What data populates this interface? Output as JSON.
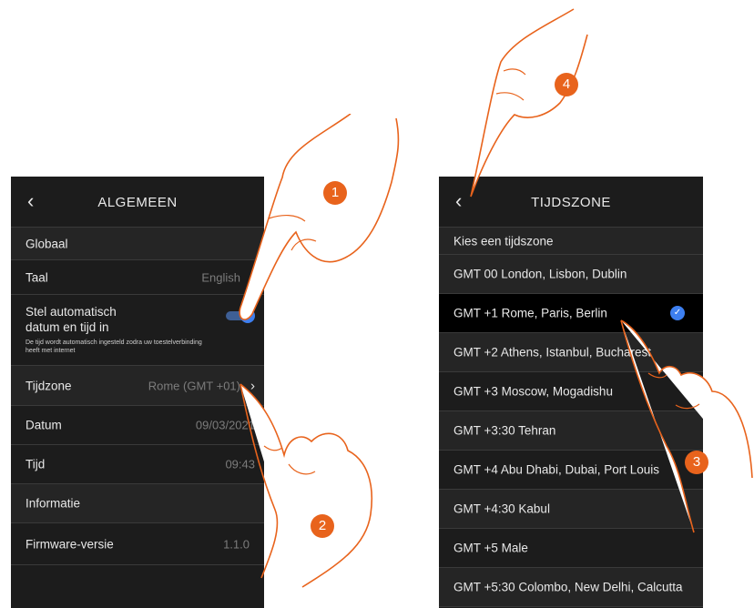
{
  "left": {
    "title": "ALGEMEEN",
    "back_icon": "‹",
    "section_global": "Globaal",
    "language_label": "Taal",
    "language_value": "English",
    "auto_line1": "Stel automatisch",
    "auto_line2": "datum en tijd in",
    "auto_hint": "De tijd wordt automatisch ingesteld zodra uw toestelverbinding heeft met internet",
    "auto_enabled": true,
    "timezone_label": "Tijdzone",
    "timezone_value": "Rome (GMT +01)",
    "date_label": "Datum",
    "date_value": "09/03/2021",
    "time_label": "Tijd",
    "time_value": "09:43",
    "section_info": "Informatie",
    "firmware_label": "Firmware-versie",
    "firmware_value": "1.1.0",
    "chevron": "›"
  },
  "right": {
    "title": "TIJDSZONE",
    "back_icon": "‹",
    "prompt": "Kies een tijdszone",
    "zones": [
      "GMT 00 London, Lisbon, Dublin",
      "GMT +1 Rome, Paris, Berlin",
      "GMT +2 Athens, Istanbul, Bucharest",
      "GMT +3 Moscow, Mogadishu",
      "GMT +3:30 Tehran",
      "GMT +4 Abu Dhabi, Dubai, Port Louis",
      "GMT +4:30 Kabul",
      "GMT +5 Male",
      "GMT +5:30 Colombo, New Delhi, Calcutta"
    ],
    "selected_index": 1,
    "check_icon": "✓"
  },
  "badges": [
    "1",
    "2",
    "3",
    "4"
  ],
  "colors": {
    "accent": "#3d7ff0",
    "badge": "#e8631c",
    "panel": "#1c1c1c"
  },
  "icons": [
    "pointing-hand-icon",
    "chevron-right-icon",
    "back-arrow-icon",
    "checkmark-icon",
    "toggle-switch"
  ]
}
